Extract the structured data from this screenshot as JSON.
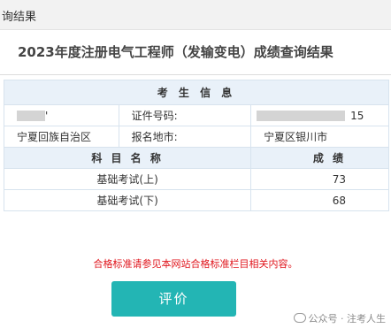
{
  "window": {
    "title": "询结果"
  },
  "page": {
    "title": "2023年度注册电气工程师（发输变电）成绩查询结果"
  },
  "candidate": {
    "header": "考 生 信 息",
    "name_suffix": "'",
    "id_label": "证件号码:",
    "id_tail": "15",
    "region": "宁夏回族自治区",
    "place_label": "报名地市:",
    "place_value": "宁夏区银川市"
  },
  "scores": {
    "subject_header": "科 目 名 称",
    "score_header": "成  绩",
    "rows": [
      {
        "subject": "基础考试(上)",
        "score": "73"
      },
      {
        "subject": "基础考试(下)",
        "score": "68"
      }
    ]
  },
  "notice": "合格标准请参见本网站合格标准栏目相关内容。",
  "evaluate_button": "评价",
  "watermark": "公众号 · 注考人生",
  "colors": {
    "button": "#23b5b4",
    "notice": "#e0151c",
    "header_bg": "#e9f1f9"
  }
}
